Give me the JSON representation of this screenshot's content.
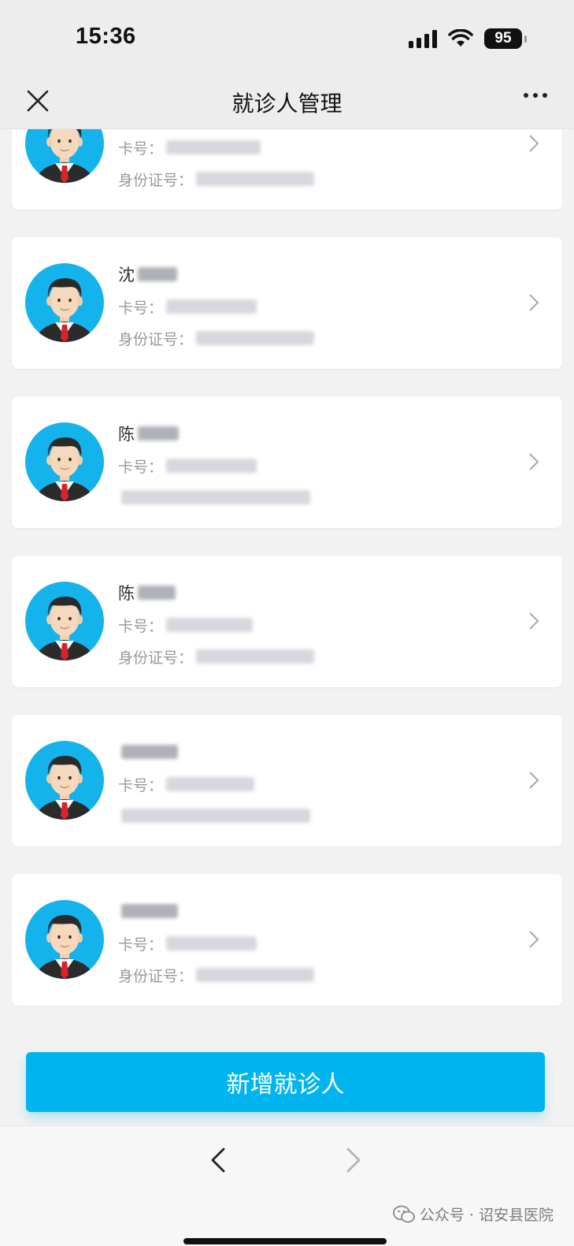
{
  "status_bar": {
    "time": "15:36",
    "battery": "95"
  },
  "nav": {
    "title": "就诊人管理",
    "close_icon": "close-icon",
    "more_icon": "more-icon"
  },
  "patients": [
    {
      "name": "",
      "card_label": "卡号：",
      "id_label": "身份证号："
    },
    {
      "name": "沈",
      "card_label": "卡号：",
      "id_label": "身份证号："
    },
    {
      "name": "陈",
      "card_label": "卡号：",
      "id_label": ""
    },
    {
      "name": "陈",
      "card_label": "卡号：",
      "id_label": "身份证号："
    },
    {
      "name": "",
      "card_label": "卡号：",
      "id_label": ""
    },
    {
      "name": "",
      "card_label": "卡号：",
      "id_label": "身份证号："
    }
  ],
  "add_button": {
    "label": "新增就诊人"
  },
  "watermark": {
    "text": "公众号 · 诏安县医院",
    "icon": "wechat-icon"
  },
  "colors": {
    "accent": "#00b5ef",
    "avatar_bg": "#14b3ec"
  }
}
